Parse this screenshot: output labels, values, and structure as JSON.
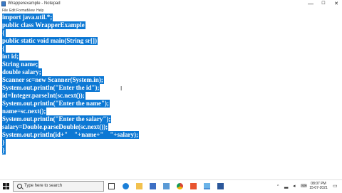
{
  "window": {
    "title": "Wrapperexample - Notepad",
    "minimize": "—",
    "maximize": "☐",
    "close": "✕"
  },
  "menu": [
    "File",
    "Edit",
    "Format",
    "View",
    "Help"
  ],
  "editor": {
    "lines": [
      "import java.util.*;",
      "public class WrapperExample",
      "{",
      "public static void main(String sr[])",
      "{",
      "int id;",
      "String name;",
      "double salary;",
      "Scanner sc=new Scanner(System.in);",
      "System.out.println(\"Enter the id\");",
      "id=Integer.parseInt(sc.next());",
      "System.out.println(\"Enter the name\");",
      "name=sc.next();",
      "System.out.println(\"Enter the salary\");",
      "salary=Double.parseDouble(sc.next());",
      "System.out.println(id+\"    \"+name+\"    \"+salary);",
      "}",
      "}"
    ],
    "selection_color": "#0c78d4"
  },
  "taskbar": {
    "search_placeholder": "Type here to search",
    "icons": [
      "start-icon",
      "task-view-icon",
      "edge-icon",
      "file-explorer-icon",
      "store-icon",
      "mail-icon",
      "chrome-icon",
      "media-icon",
      "notepad-icon",
      "app-icon"
    ],
    "tray_caret": "^",
    "time": "08:07 PM",
    "date": "15-07-2021"
  }
}
